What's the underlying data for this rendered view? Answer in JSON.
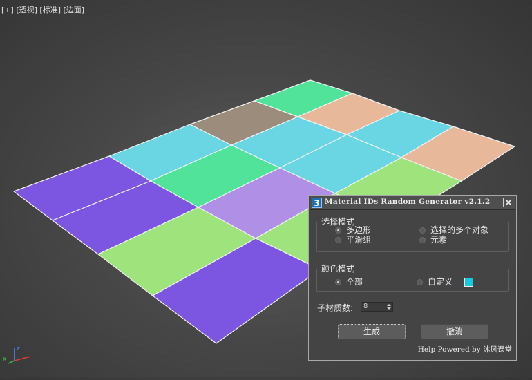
{
  "viewport": {
    "labels": [
      "[+]",
      "[透视]",
      "[标准]",
      "[边面]"
    ],
    "axis_labels": {
      "x": "x",
      "z": "z"
    },
    "tile_colors": {
      "green": "#52e39b",
      "taupe": "#9c8c7c",
      "peach": "#e8b89b",
      "cyan": "#6ad6e3",
      "purple": "#7c56e0",
      "lavender": "#b08fe6",
      "lightgreen": "#9fe37d"
    }
  },
  "dialog": {
    "icon": "3",
    "title": "Material IDs Random Generator v2.1.2",
    "select_mode": {
      "title": "选择模式",
      "options": [
        "多边形",
        "选择的多个对象",
        "平滑组",
        "元素"
      ],
      "selected": "多边形"
    },
    "color_mode": {
      "title": "颜色模式",
      "options": [
        "全部",
        "自定义"
      ],
      "selected": "全部",
      "custom_color": "#16c8e0"
    },
    "submat_count": {
      "label": "子材质数:",
      "value": "8"
    },
    "buttons": {
      "generate": "生成",
      "cancel": "撤消"
    },
    "footer": {
      "help": "Help",
      "powered": "Powered by 沐风课堂"
    }
  }
}
